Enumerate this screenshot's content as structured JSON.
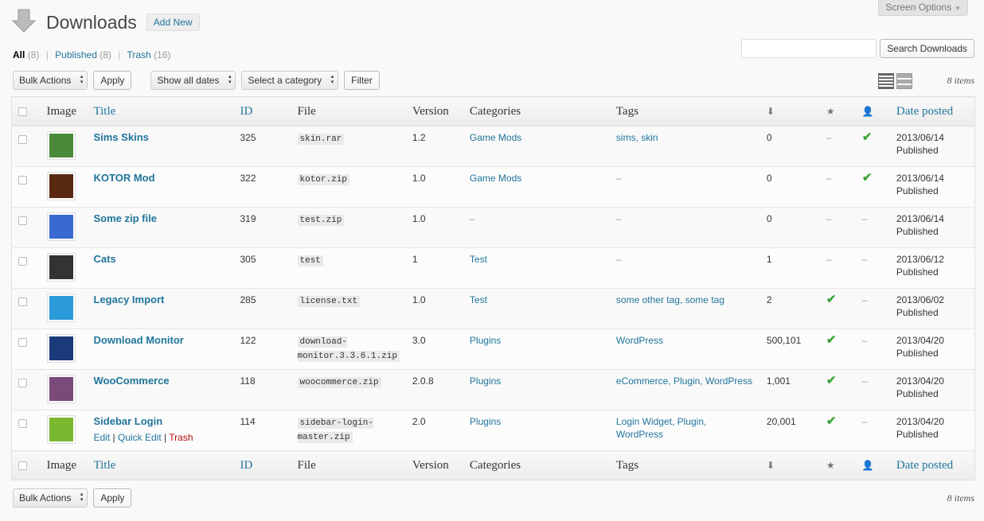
{
  "screen_options": "Screen Options",
  "page_title": "Downloads",
  "add_new": "Add New",
  "filters": [
    {
      "label": "All",
      "count": "(8)",
      "current": true
    },
    {
      "label": "Published",
      "count": "(8)",
      "current": false
    },
    {
      "label": "Trash",
      "count": "(16)",
      "current": false
    }
  ],
  "search_button": "Search Downloads",
  "bulk_actions": "Bulk Actions",
  "apply": "Apply",
  "dates_select": "Show all dates",
  "category_select": "Select a category",
  "filter_button": "Filter",
  "items_count": "8 items",
  "columns": {
    "image": "Image",
    "title": "Title",
    "id": "ID",
    "file": "File",
    "version": "Version",
    "categories": "Categories",
    "tags": "Tags",
    "date": "Date posted"
  },
  "icons": {
    "downloads_col": "download-count-icon",
    "featured_col": "star-icon",
    "members_col": "person-icon"
  },
  "row_actions": {
    "edit": "Edit",
    "quick_edit": "Quick Edit",
    "trash": "Trash",
    "sep": "|"
  },
  "rows": [
    {
      "title": "Sims Skins",
      "id": "325",
      "file": "skin.rar",
      "version": "1.2",
      "categories": "Game Mods",
      "tags": "sims, skin",
      "downloads": "0",
      "featured": "–",
      "members": "✔",
      "date": "2013/06/14",
      "status": "Published",
      "thumb": "#4a8a3a"
    },
    {
      "title": "KOTOR Mod",
      "id": "322",
      "file": "kotor.zip",
      "version": "1.0",
      "categories": "Game Mods",
      "tags": "–",
      "downloads": "0",
      "featured": "–",
      "members": "✔",
      "date": "2013/06/14",
      "status": "Published",
      "thumb": "#5a2a10"
    },
    {
      "title": "Some zip file",
      "id": "319",
      "file": "test.zip",
      "version": "1.0",
      "categories": "–",
      "tags": "–",
      "downloads": "0",
      "featured": "–",
      "members": "–",
      "date": "2013/06/14",
      "status": "Published",
      "thumb": "#3a6ad0"
    },
    {
      "title": "Cats",
      "id": "305",
      "file": "test",
      "version": "1",
      "categories": "Test",
      "tags": "–",
      "downloads": "1",
      "featured": "–",
      "members": "–",
      "date": "2013/06/12",
      "status": "Published",
      "thumb": "#333333"
    },
    {
      "title": "Legacy Import",
      "id": "285",
      "file": "license.txt",
      "version": "1.0",
      "categories": "Test",
      "tags": "some other tag, some tag",
      "downloads": "2",
      "featured": "✔",
      "members": "–",
      "date": "2013/06/02",
      "status": "Published",
      "thumb": "#2a9ad8"
    },
    {
      "title": "Download Monitor",
      "id": "122",
      "file": "download-monitor.3.3.6.1.zip",
      "version": "3.0",
      "categories": "Plugins",
      "tags": "WordPress",
      "downloads": "500,101",
      "featured": "✔",
      "members": "–",
      "date": "2013/04/20",
      "status": "Published",
      "thumb": "#1a3a7a"
    },
    {
      "title": "WooCommerce",
      "id": "118",
      "file": "woocommerce.zip",
      "version": "2.0.8",
      "categories": "Plugins",
      "tags": "eCommerce, Plugin, WordPress",
      "downloads": "1,001",
      "featured": "✔",
      "members": "–",
      "date": "2013/04/20",
      "status": "Published",
      "thumb": "#7a4a7a"
    },
    {
      "title": "Sidebar Login",
      "id": "114",
      "file": "sidebar-login-master.zip",
      "version": "2.0",
      "categories": "Plugins",
      "tags": "Login Widget, Plugin, WordPress",
      "downloads": "20,001",
      "featured": "✔",
      "members": "–",
      "date": "2013/04/20",
      "status": "Published",
      "thumb": "#7ab830"
    }
  ]
}
